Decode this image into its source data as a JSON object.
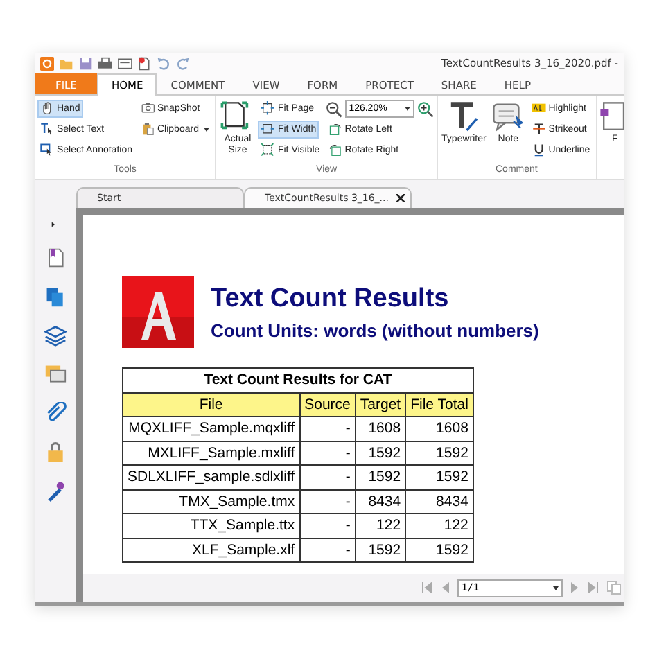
{
  "window": {
    "title": "TextCountResults 3_16_2020.pdf -"
  },
  "menu_tabs": [
    {
      "label": "FILE",
      "kind": "file",
      "selected": false
    },
    {
      "label": "HOME",
      "kind": "tab",
      "selected": true
    },
    {
      "label": "COMMENT",
      "kind": "tab",
      "selected": false
    },
    {
      "label": "VIEW",
      "kind": "tab",
      "selected": false
    },
    {
      "label": "FORM",
      "kind": "tab",
      "selected": false
    },
    {
      "label": "PROTECT",
      "kind": "tab",
      "selected": false
    },
    {
      "label": "SHARE",
      "kind": "tab",
      "selected": false
    },
    {
      "label": "HELP",
      "kind": "tab",
      "selected": false
    }
  ],
  "ribbon_groups": [
    {
      "label": "Tools",
      "columns": [
        [
          {
            "kind": "small",
            "label": "Hand",
            "selected": true
          },
          {
            "kind": "small",
            "label": "Select Text",
            "selected": false
          },
          {
            "kind": "small",
            "label": "Select Annotation",
            "selected": false
          }
        ],
        [
          {
            "kind": "small",
            "label": "SnapShot",
            "selected": false
          },
          {
            "kind": "dropdown",
            "label": "Clipboard",
            "selected": false
          }
        ]
      ]
    },
    {
      "label": "View",
      "columns": [
        [
          {
            "kind": "large",
            "label": "Actual Size",
            "selected": false
          }
        ],
        [
          {
            "kind": "small",
            "label": "Fit Page",
            "selected": false
          },
          {
            "kind": "small",
            "label": "Fit Width",
            "selected": true
          },
          {
            "kind": "small",
            "label": "Fit Visible",
            "selected": false
          }
        ],
        [
          {
            "kind": "zoom",
            "value": "126.20%"
          },
          {
            "kind": "small",
            "label": "Rotate Left",
            "selected": false
          },
          {
            "kind": "small",
            "label": "Rotate Right",
            "selected": false
          }
        ]
      ]
    },
    {
      "label": "Comment",
      "columns": [
        [
          {
            "kind": "large",
            "label": "Typewriter",
            "selected": false
          }
        ],
        [
          {
            "kind": "large",
            "label": "Note",
            "selected": false
          }
        ],
        [
          {
            "kind": "small",
            "label": "Highlight",
            "selected": false
          },
          {
            "kind": "small",
            "label": "Strikeout",
            "selected": false
          },
          {
            "kind": "small",
            "label": "Underline",
            "selected": false
          }
        ]
      ]
    },
    {
      "columns": [
        [
          {
            "kind": "large",
            "label": "F",
            "selected": false
          }
        ]
      ]
    }
  ],
  "doc_tabs": [
    {
      "label": "Start",
      "selected": false,
      "closable": false
    },
    {
      "label": "TextCountResults 3_16_...",
      "selected": true,
      "closable": true
    }
  ],
  "document": {
    "heading": "Text Count Results",
    "subheading": "Count Units: words (without numbers)",
    "table": {
      "title": "Text Count Results for CAT",
      "columns": [
        "File",
        "Source",
        "Target",
        "File Total"
      ],
      "rows": [
        [
          "MQXLIFF_Sample.mqxliff",
          "-",
          "1608",
          "1608"
        ],
        [
          "MXLIFF_Sample.mxliff",
          "-",
          "1592",
          "1592"
        ],
        [
          "SDLXLIFF_sample.sdlxliff",
          "-",
          "1592",
          "1592"
        ],
        [
          "TMX_Sample.tmx",
          "-",
          "8434",
          "8434"
        ],
        [
          "TTX_Sample.ttx",
          "-",
          "122",
          "122"
        ],
        [
          "XLF_Sample.xlf",
          "-",
          "1592",
          "1592"
        ]
      ]
    }
  },
  "page_nav": {
    "page": "1/1"
  }
}
